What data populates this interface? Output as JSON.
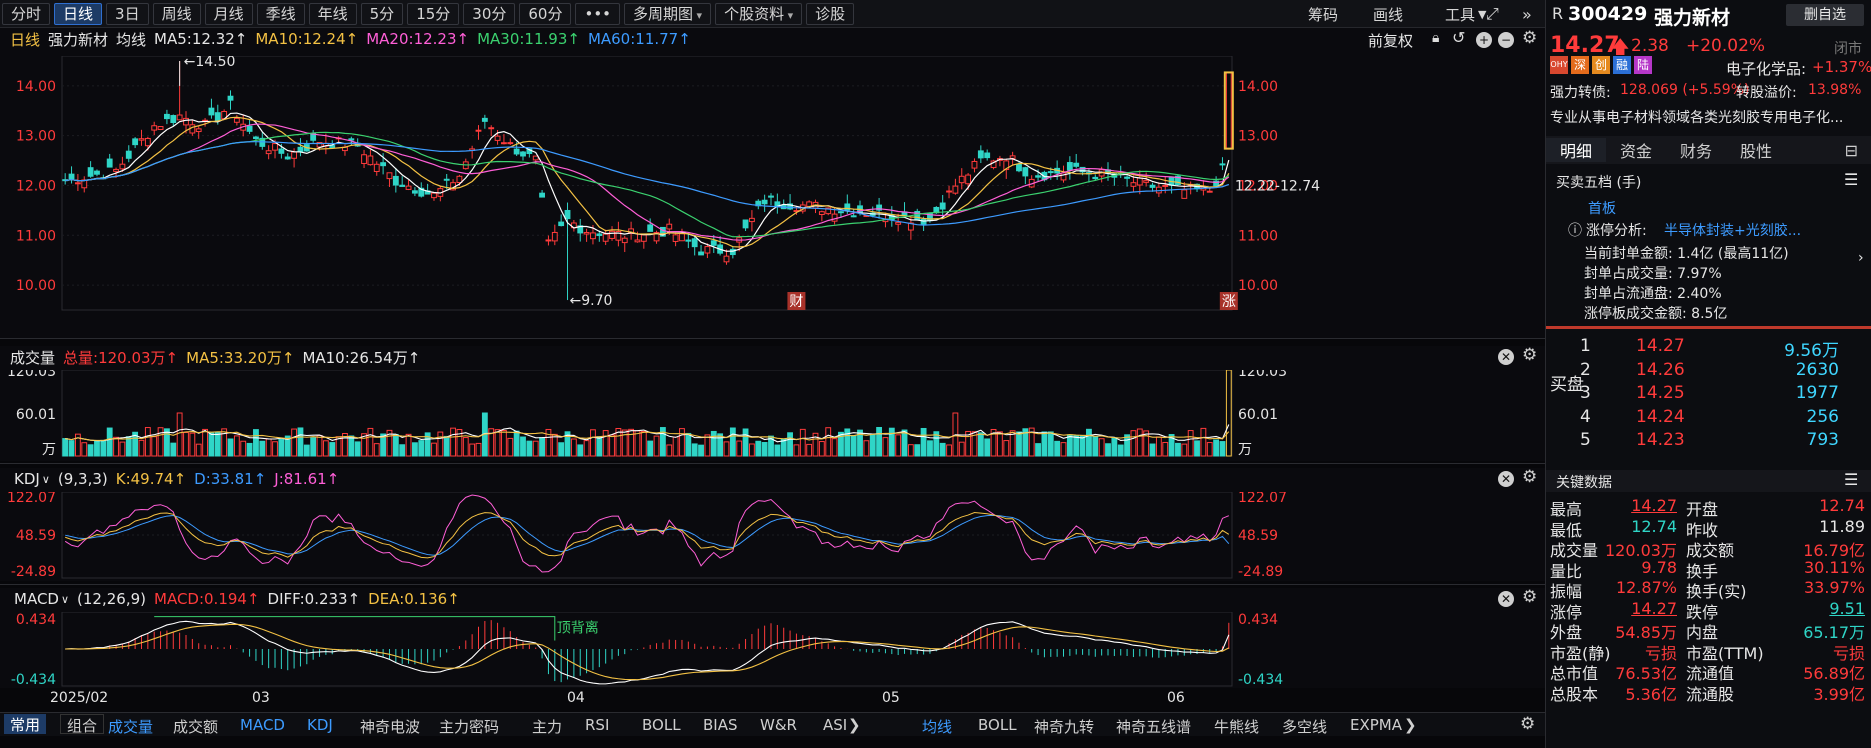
{
  "toolbar": {
    "periods": [
      "分时",
      "日线",
      "3日",
      "周线",
      "月线",
      "季线",
      "年线",
      "5分",
      "15分",
      "30分",
      "60分",
      "•••",
      "多周期图",
      "个股资料",
      "诊股"
    ],
    "active": "日线",
    "right": [
      "筹码",
      "画线",
      "工具"
    ]
  },
  "main_header": {
    "period": "日线",
    "name": "强力新材",
    "ma_label": "均线",
    "ma5": "MA5:12.32↑",
    "ma10": "MA10:12.24↑",
    "ma20": "MA20:12.23↑",
    "ma30": "MA30:11.93↑",
    "ma60": "MA60:11.77↑",
    "adjust": "前复权"
  },
  "price_axis": [
    "14.00",
    "13.00",
    "12.00",
    "11.00",
    "10.00"
  ],
  "annotations": {
    "high": "←14.50",
    "low": "←9.70",
    "range": "12.22-12.74",
    "fin": "财",
    "zhang": "涨"
  },
  "volume_header": {
    "title": "成交量",
    "total": "总量:120.03万↑",
    "ma5": "MA5:33.20万↑",
    "ma10": "MA10:26.54万↑"
  },
  "volume_axis": [
    "120.03",
    "60.01",
    "万"
  ],
  "kdj_header": {
    "title": "KDJ",
    "params": "(9,3,3)",
    "k": "K:49.74↑",
    "d": "D:33.81↑",
    "j": "J:81.61↑"
  },
  "kdj_axis": [
    "122.07",
    "48.59",
    "-24.89"
  ],
  "macd_header": {
    "title": "MACD",
    "params": "(12,26,9)",
    "macd": "MACD:0.194↑",
    "diff": "DIFF:0.233↑",
    "dea": "DEA:0.136↑"
  },
  "macd_axis": [
    "0.434",
    "-0.434"
  ],
  "macd_label": "顶背离",
  "date_axis": [
    "2025/02",
    "03",
    "04",
    "05",
    "06"
  ],
  "bottom_tabs_left": [
    "常用",
    "组合"
  ],
  "bottom_tabs_ind": [
    "成交量",
    "成交额",
    "MACD",
    "KDJ",
    "神奇电波",
    "主力密码",
    "主力",
    "RSI",
    "BOLL",
    "BIAS",
    "W&R",
    "ASI"
  ],
  "bottom_tabs_main": [
    "均线",
    "BOLL",
    "神奇九转",
    "神奇五线谱",
    "牛熊线",
    "多空线",
    "EXPMA"
  ],
  "stock": {
    "code": "300429",
    "name": "强力新材",
    "price": "14.27",
    "change": "2.38",
    "pct": "+20.02%",
    "status": "闭市",
    "watch": "删自选",
    "badges": [
      "OHY",
      "深",
      "创",
      "融",
      "陆"
    ],
    "sector": "电子化学品:",
    "sector_pct": "+1.37%",
    "bond_label": "强力转债:",
    "bond_val": "128.069 (+5.59%)",
    "premium_label": "转股溢价:",
    "premium_val": "13.98%",
    "desc": "专业从事电子材料领域各类光刻胶专用电子化..."
  },
  "right_tabs": [
    "明细",
    "资金",
    "财务",
    "股性"
  ],
  "book_title": "买卖五档 (手)",
  "limit_info": {
    "first": "首板",
    "analysis_label": "涨停分析:",
    "analysis": "半导体封装+光刻胶...",
    "r1": "当前封单金额: 1.4亿 (最高11亿)",
    "r2": "封单占成交量: 7.97%",
    "r3": "封单占流通盘: 2.40%",
    "r4": "涨停板成交金额: 8.5亿"
  },
  "buy_label": "买盘",
  "buy_rows": [
    {
      "i": "1",
      "p": "14.27",
      "v": "9.56万"
    },
    {
      "i": "2",
      "p": "14.26",
      "v": "2630"
    },
    {
      "i": "3",
      "p": "14.25",
      "v": "1977"
    },
    {
      "i": "4",
      "p": "14.24",
      "v": "256"
    },
    {
      "i": "5",
      "p": "14.23",
      "v": "793"
    }
  ],
  "key_title": "关键数据",
  "key_rows": [
    [
      "最高",
      "14.27",
      "开盘",
      "12.74"
    ],
    [
      "最低",
      "12.74",
      "昨收",
      "11.89"
    ],
    [
      "成交量",
      "120.03万",
      "成交额",
      "16.79亿"
    ],
    [
      "量比",
      "9.78",
      "换手",
      "30.11%"
    ],
    [
      "振幅",
      "12.87%",
      "换手(实)",
      "33.97%"
    ],
    [
      "涨停",
      "14.27",
      "跌停",
      "9.51"
    ],
    [
      "外盘",
      "54.85万",
      "内盘",
      "65.17万"
    ],
    [
      "市盈(静)",
      "亏损",
      "市盈(TTM)",
      "亏损"
    ],
    [
      "总市值",
      "76.53亿",
      "流通值",
      "56.89亿"
    ],
    [
      "总股本",
      "5.36亿",
      "流通股",
      "3.99亿"
    ]
  ],
  "chart_data": {
    "type": "candlestick",
    "ohlc_approx_last": {
      "open": 12.74,
      "high": 14.27,
      "low": 12.74,
      "close": 14.27
    },
    "price_range": [
      9.5,
      14.6
    ],
    "high_marker": 14.5,
    "low_marker": 9.7,
    "volume_max": 120.03,
    "kdj_range": [
      -24.89,
      122.07
    ],
    "macd_range": [
      -0.434,
      0.434
    ]
  },
  "colors": {
    "up": "#ff3b3b",
    "down": "#2fd5c7",
    "ma5": "#ffffff",
    "ma10": "#f3c144",
    "ma20": "#ff5fd7",
    "ma30": "#3bd16f",
    "ma60": "#3d9bff",
    "accent": "#2f6fd0"
  }
}
